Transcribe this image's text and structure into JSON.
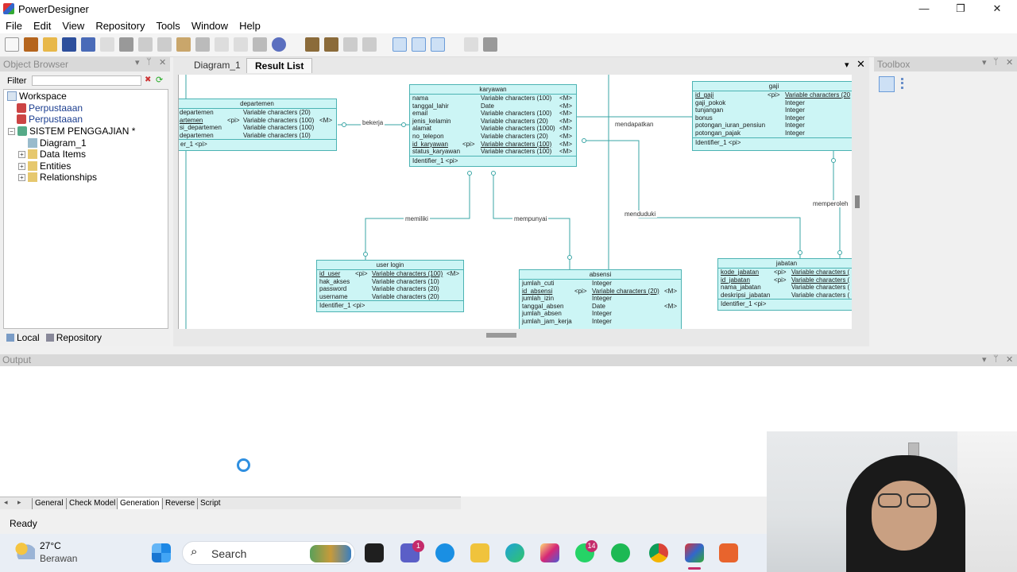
{
  "window": {
    "title": "PowerDesigner",
    "min": "—",
    "max": "❐",
    "close": "✕"
  },
  "menu": [
    "File",
    "Edit",
    "View",
    "Repository",
    "Tools",
    "Window",
    "Help"
  ],
  "object_browser": {
    "title": "Object Browser",
    "filter_label": "Filter",
    "tree": [
      "Workspace",
      "Perpustaaan",
      "Perpustaaan",
      "SISTEM PENGGAJIAN *",
      "Diagram_1",
      "Data Items",
      "Entities",
      "Relationships"
    ],
    "tabs": [
      "Local",
      "Repository"
    ]
  },
  "diagram": {
    "tabs": [
      "Diagram_1",
      "Result List"
    ],
    "entities": {
      "departemen": {
        "name": "departemen",
        "rows": [
          [
            "departemen",
            "",
            "Variable characters (20)",
            ""
          ],
          [
            "artemen",
            "<pi>",
            "Variable characters (100)",
            "<M>"
          ],
          [
            "si_departemen",
            "",
            "Variable characters (100)",
            ""
          ],
          [
            "departemen",
            "",
            "Variable characters (10)",
            ""
          ]
        ],
        "identifier": "er_1 <pi>"
      },
      "karyawan": {
        "name": "karyawan",
        "rows": [
          [
            "nama",
            "",
            "Variable characters (100)",
            "<M>"
          ],
          [
            "tanggal_lahir",
            "",
            "Date",
            "<M>"
          ],
          [
            "email",
            "",
            "Variable characters (100)",
            "<M>"
          ],
          [
            "jenis_kelamin",
            "",
            "Variable characters (20)",
            "<M>"
          ],
          [
            "alamat",
            "",
            "Variable characters (1000)",
            "<M>"
          ],
          [
            "no_telepon",
            "",
            "Variable characters (20)",
            "<M>"
          ],
          [
            "id_karyawan",
            "<pi>",
            "Variable characters (100)",
            "<M>"
          ],
          [
            "status_karyawan",
            "",
            "Variable characters (100)",
            "<M>"
          ]
        ],
        "identifier": "Identifier_1 <pi>"
      },
      "gaji": {
        "name": "gaji",
        "rows": [
          [
            "id_gaji",
            "<pi>",
            "Variable characters (20",
            ""
          ],
          [
            "gaji_pokok",
            "",
            "Integer",
            ""
          ],
          [
            "tunjangan",
            "",
            "Integer",
            ""
          ],
          [
            "bonus",
            "",
            "Integer",
            ""
          ],
          [
            "potongan_iuran_pensiun",
            "",
            "Integer",
            ""
          ],
          [
            "potongan_pajak",
            "",
            "Integer",
            ""
          ]
        ],
        "identifier": "Identifier_1 <pi>"
      },
      "userlogin": {
        "name": "user login",
        "rows": [
          [
            "id_user",
            "<pi>",
            "Variable characters (100)",
            "<M>"
          ],
          [
            "hak_akses",
            "",
            "Variable characters (10)",
            ""
          ],
          [
            "password",
            "",
            "Variable characters (20)",
            ""
          ],
          [
            "username",
            "",
            "Variable characters (20)",
            ""
          ]
        ],
        "identifier": "Identifier_1 <pi>"
      },
      "absensi": {
        "name": "absensi",
        "rows": [
          [
            "jumlah_cuti",
            "",
            "Integer",
            ""
          ],
          [
            "id_absensi",
            "<pi>",
            "Variable characters (20)",
            "<M>"
          ],
          [
            "jumlah_izin",
            "",
            "Integer",
            ""
          ],
          [
            "tanggal_absen",
            "",
            "Date",
            "<M>"
          ],
          [
            "jumlah_absen",
            "",
            "Integer",
            ""
          ],
          [
            "jumlah_jam_kerja",
            "",
            "Integer",
            ""
          ]
        ],
        "identifier": ""
      },
      "jabatan": {
        "name": "jabatan",
        "rows": [
          [
            "kode_jabatan",
            "<pi>",
            "Variable characters (",
            ""
          ],
          [
            "id_jabatan",
            "<pi>",
            "Variable characters (",
            ""
          ],
          [
            "nama_jabatan",
            "",
            "Variable characters (",
            ""
          ],
          [
            "deskripsi_jabatan",
            "",
            "Variable characters (",
            ""
          ]
        ],
        "identifier": "Identifier_1 <pi>"
      }
    },
    "relations": [
      "bekerja",
      "mendapatkan",
      "memiliki",
      "mempunyai",
      "menduduki",
      "memperoleh"
    ]
  },
  "toolbox": {
    "title": "Toolbox"
  },
  "output": {
    "title": "Output",
    "tabs": [
      "General",
      "Check Model",
      "Generation",
      "Reverse",
      "Script"
    ]
  },
  "status": {
    "text": "Ready"
  },
  "taskbar": {
    "temp": "27°C",
    "weather": "Berawan",
    "search": "Search",
    "badges": [
      "1",
      "14"
    ]
  }
}
